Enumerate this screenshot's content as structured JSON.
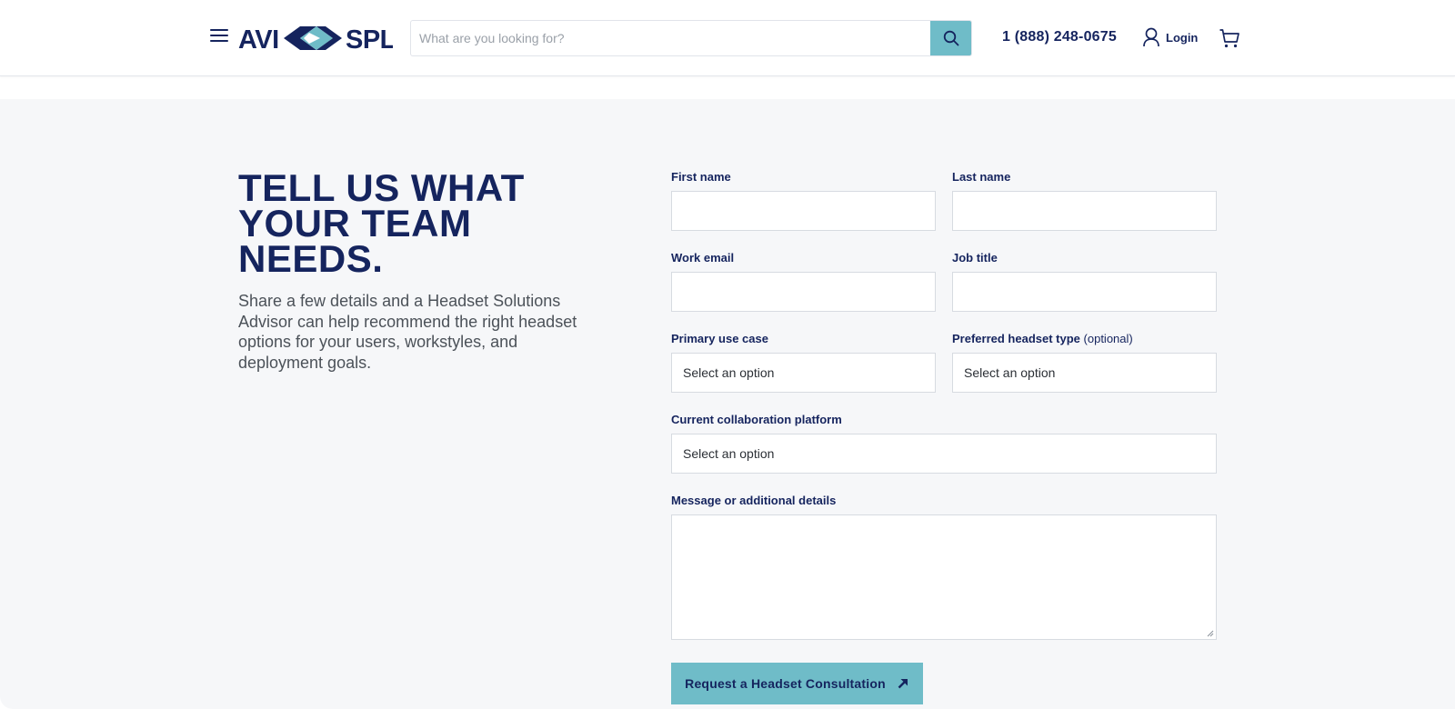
{
  "header": {
    "logo_text": "AVI-SPL",
    "search": {
      "placeholder": "What are you looking for?",
      "value": ""
    },
    "phone": "1 (888) 248-0675",
    "login_label": "Login",
    "icons": {
      "menu": "hamburger-menu-icon",
      "search": "magnifier-icon",
      "user": "user-icon",
      "cart": "shopping-cart-icon"
    }
  },
  "hero": {
    "heading_lines": [
      "TELL US WHAT",
      "YOUR TEAM",
      "NEEDS."
    ],
    "intro": "Share a few details and a Headset Solutions Advisor can help recommend the right headset options for your users, workstyles, and deployment goals."
  },
  "form": {
    "first_name": {
      "label": "First name",
      "value": ""
    },
    "last_name": {
      "label": "Last name",
      "value": ""
    },
    "work_email": {
      "label": "Work email",
      "value": ""
    },
    "job_title": {
      "label": "Job title",
      "value": ""
    },
    "primary_use_case": {
      "label": "Primary use case",
      "selected": "Select an option"
    },
    "preferred_headset_type": {
      "label": "Preferred headset type",
      "optional": "(optional)",
      "selected": "Select an option"
    },
    "collaboration_platform": {
      "label": "Current collaboration platform",
      "selected": "Select an option"
    },
    "message": {
      "label": "Message or additional details",
      "value": ""
    },
    "submit_label": "Request a Headset Consultation"
  },
  "colors": {
    "navy": "#15245e",
    "accent_teal": "#6fbcc8",
    "section_bg": "#f6f7f9",
    "border": "#d7dbe1"
  }
}
